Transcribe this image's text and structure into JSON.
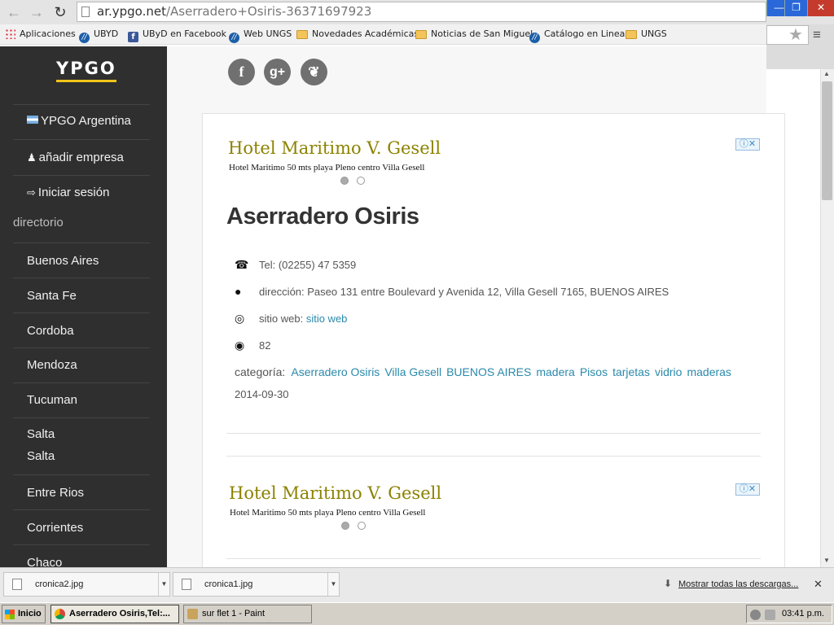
{
  "browser": {
    "url_domain": "ar.ypgo.net",
    "url_path": "/Aserradero+Osiris-36371697923",
    "back_icon": "back-arrow-icon",
    "forward_icon": "forward-arrow-icon",
    "reload_icon": "reload-icon",
    "bookmarks": [
      {
        "label": "Aplicaciones",
        "icon": "apps-grid-icon"
      },
      {
        "label": "UBYD",
        "icon": "ungs-logo-icon"
      },
      {
        "label": "UByD en Facebook",
        "icon": "facebook-icon"
      },
      {
        "label": "Web UNGS",
        "icon": "ungs-logo-icon"
      },
      {
        "label": "Novedades Académicas",
        "icon": "folder-icon"
      },
      {
        "label": "Noticias de San Miguel",
        "icon": "folder-icon"
      },
      {
        "label": "Catálogo en Linea",
        "icon": "ungs-logo-icon"
      },
      {
        "label": "UNGS",
        "icon": "folder-icon"
      }
    ]
  },
  "sidebar": {
    "logo": "YPGO",
    "top_items": [
      {
        "label": "YPGO Argentina",
        "icon": "argentina-flag-icon"
      },
      {
        "label": "añadir empresa",
        "icon": "add-user-icon"
      },
      {
        "label": "Iniciar sesión",
        "icon": "login-icon"
      }
    ],
    "directory_heading": "directorio",
    "directory_items": [
      "Buenos Aires",
      "Santa Fe",
      "Cordoba",
      "Mendoza",
      "Tucuman",
      "Salta",
      "Salta",
      "Entre Rios",
      "Corrientes",
      "Chaco"
    ]
  },
  "social": {
    "icons": [
      "facebook-icon",
      "google-plus-icon",
      "twitter-icon"
    ],
    "google_glyph": "g+"
  },
  "ad": {
    "title": "Hotel Maritimo V. Gesell",
    "subtitle": "Hotel Maritimo 50 mts playa Pleno centro Villa Gesell"
  },
  "business": {
    "name": "Aserradero Osiris",
    "phone": "Tel: (02255) 47 5359",
    "address": "dirección: Paseo 131 entre Boulevard y Avenida 12, Villa Gesell 7165, BUENOS AIRES",
    "website_label": "sitio web:",
    "website_link": "sitio web",
    "views": "82",
    "category_label": "categoría:",
    "categories": [
      "Aserradero Osiris",
      "Villa Gesell",
      "BUENOS AIRES",
      "madera",
      "Pisos",
      "tarjetas",
      "vidrio",
      "maderas"
    ],
    "date": "2014-09-30"
  },
  "downloads": {
    "items": [
      "cronica2.jpg",
      "cronica1.jpg"
    ],
    "show_all": "Mostrar todas las descargas..."
  },
  "taskbar": {
    "start": "Inicio",
    "windows": [
      "Aserradero Osiris,Tel:...",
      "sur flet 1 - Paint"
    ],
    "clock": "03:41 p.m."
  },
  "colors": {
    "sidebar_bg": "#2f2f2f",
    "logo_underline": "#f0c419",
    "link": "#2a8aab",
    "ad_title": "#8c8200"
  }
}
